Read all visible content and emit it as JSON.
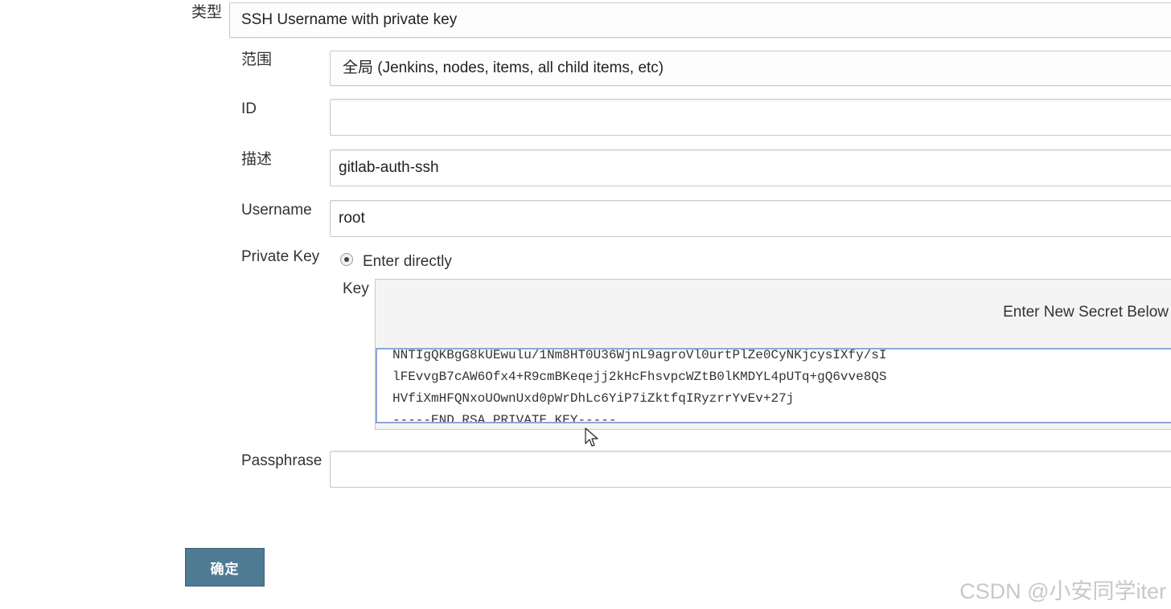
{
  "form": {
    "type_label": "类型",
    "type_value": "SSH Username with private key",
    "scope_label": "范围",
    "scope_value": "全局 (Jenkins, nodes, items, all child items, etc)",
    "id_label": "ID",
    "id_value": "",
    "description_label": "描述",
    "description_value": "gitlab-auth-ssh",
    "username_label": "Username",
    "username_value": "root",
    "private_key_label": "Private Key",
    "enter_directly_label": "Enter directly",
    "key_label": "Key",
    "secret_hint": "Enter New Secret Below",
    "key_lines": [
      "NNTIgQKBgG8kUEwulu/1Nm8HT0U36WjnL9agroVl0urtPlZe0CyNKjcysIXfy/sI",
      "lFEvvgB7cAW6Ofx4+R9cmBKeqejj2kHcFhsvpcWZtB0lKMDYL4pUTq+gQ6vve8QS",
      "HVfiXmHFQNxoUOwnUxd0pWrDhLc6YiP7iZktfqIRyzrrYvEv+27j"
    ],
    "key_end_prefix": "-----END ",
    "key_end_rsa": "RSA",
    "key_end_suffix": " PRIVATE KEY-----",
    "passphrase_label": "Passphrase",
    "passphrase_value": "",
    "confirm_label": "确定"
  },
  "watermark": "CSDN @小安同学iter",
  "icons": {
    "radio": "radio-selected",
    "cursor": "mouse-pointer-icon"
  }
}
